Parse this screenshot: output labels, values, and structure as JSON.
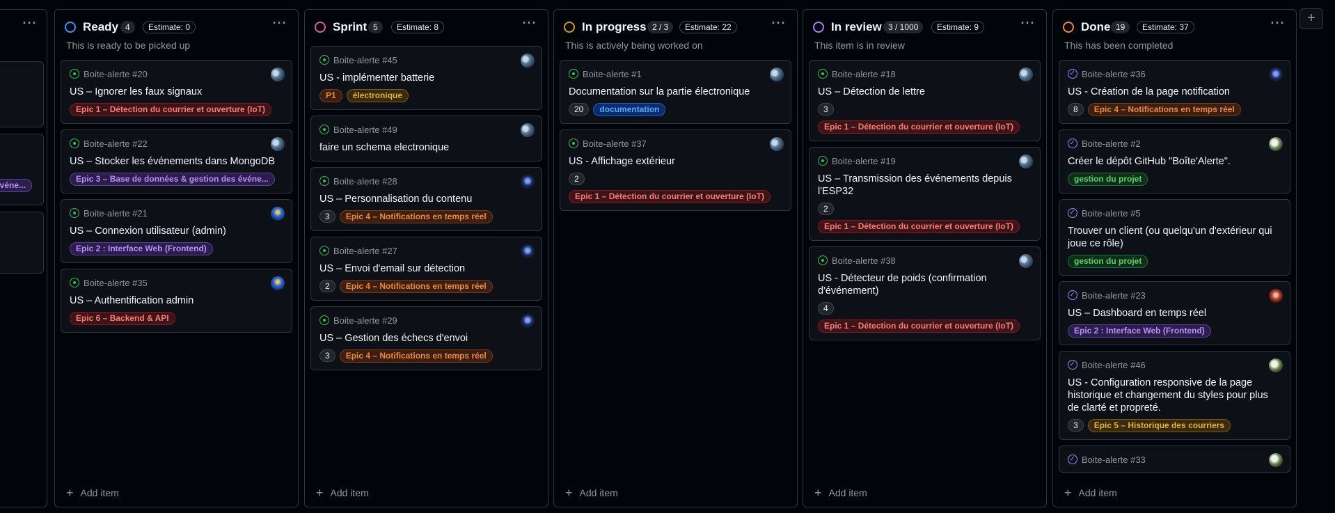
{
  "colors": {
    "ready": "#4493f8",
    "sprint": "#db61a2",
    "in_progress": "#d29922",
    "in_review": "#ab7df8",
    "done": "#f0883e",
    "open_issue": "#3fb950",
    "closed_issue": "#ab7df8"
  },
  "label_styles": {
    "epic1": {
      "bg": "#3b1519",
      "fg": "#ff7b72",
      "border": "#8e1519"
    },
    "epic2": {
      "bg": "#2a1f4a",
      "fg": "#bc8cff",
      "border": "#5a3fa0"
    },
    "epic3": {
      "bg": "#2a1f4a",
      "fg": "#bc8cff",
      "border": "#5a3fa0"
    },
    "epic4": {
      "bg": "#3a1f12",
      "fg": "#f0883e",
      "border": "#7a3a1a"
    },
    "epic5": {
      "bg": "#3a2a0e",
      "fg": "#e3b341",
      "border": "#7a5a12"
    },
    "epic6": {
      "bg": "#3b1519",
      "fg": "#ff7b72",
      "border": "#8e1519"
    },
    "p1": {
      "bg": "#3a1f12",
      "fg": "#f0883e",
      "border": "#7a3a1a"
    },
    "electronique": {
      "bg": "#3a2a0e",
      "fg": "#e3b341",
      "border": "#7a5a12"
    },
    "documentation": {
      "bg": "#0c2d6b",
      "fg": "#58a6ff",
      "border": "#1f5bc4"
    },
    "gestion": {
      "bg": "#0f2e1a",
      "fg": "#56d364",
      "border": "#1f6f36"
    }
  },
  "columns": [
    {
      "title": "Ready",
      "count": "4",
      "estimate": "Estimate: 0",
      "description": "This is ready to be picked up",
      "add_item": "Add item",
      "cards": [
        {
          "ref": "Boite-alerte #20",
          "title": "US – Ignorer les faux signaux",
          "avatar": "avatar-landscape",
          "labels": [
            {
              "text": "Epic 1 – Détection du courrier et ouverture (IoT)",
              "style": "epic1"
            }
          ]
        },
        {
          "ref": "Boite-alerte #22",
          "title": "US – Stocker les événements dans MongoDB",
          "avatar": "avatar-landscape",
          "labels": [
            {
              "text": "Epic 3 – Base de données & gestion des événe...",
              "style": "epic3"
            }
          ]
        },
        {
          "ref": "Boite-alerte #21",
          "title": "US – Connexion utilisateur (admin)",
          "avatar": "avatar-blue",
          "labels": [
            {
              "text": "Epic 2 : Interface Web (Frontend)",
              "style": "epic2"
            }
          ]
        },
        {
          "ref": "Boite-alerte #35",
          "title": "US – Authentification admin",
          "avatar": "avatar-blue",
          "labels": [
            {
              "text": "Epic 6 – Backend & API",
              "style": "epic6"
            }
          ]
        }
      ]
    },
    {
      "title": "Sprint",
      "count": "5",
      "estimate": "Estimate: 8",
      "description": "",
      "add_item": "Add item",
      "cards": [
        {
          "ref": "Boite-alerte #45",
          "title": "US - implémenter batterie",
          "avatar": "avatar-landscape",
          "labels": [
            {
              "text": "P1",
              "style": "p1"
            },
            {
              "text": "électronique",
              "style": "electronique"
            }
          ]
        },
        {
          "ref": "Boite-alerte #49",
          "title": "faire un schema electronique",
          "avatar": "avatar-landscape",
          "labels": []
        },
        {
          "ref": "Boite-alerte #28",
          "title": "US – Personnalisation du contenu",
          "avatar": "avatar-dark",
          "num": "3",
          "labels": [
            {
              "text": "Epic 4 – Notifications en temps réel",
              "style": "epic4"
            }
          ]
        },
        {
          "ref": "Boite-alerte #27",
          "title": "US – Envoi d'email sur détection",
          "avatar": "avatar-dark",
          "num": "2",
          "labels": [
            {
              "text": "Epic 4 – Notifications en temps réel",
              "style": "epic4"
            }
          ]
        },
        {
          "ref": "Boite-alerte #29",
          "title": "US – Gestion des échecs d'envoi",
          "avatar": "avatar-dark",
          "num": "3",
          "labels": [
            {
              "text": "Epic 4 – Notifications en temps réel",
              "style": "epic4"
            }
          ]
        }
      ]
    },
    {
      "title": "In progress",
      "count": "2 / 3",
      "estimate": "Estimate: 22",
      "description": "This is actively being worked on",
      "add_item": "Add item",
      "cards": [
        {
          "ref": "Boite-alerte #1",
          "title": "Documentation sur la partie électronique",
          "avatar": "avatar-landscape",
          "num": "20",
          "labels": [
            {
              "text": "documentation",
              "style": "documentation"
            }
          ]
        },
        {
          "ref": "Boite-alerte #37",
          "title": "US - Affichage extérieur",
          "avatar": "avatar-landscape",
          "num": "2",
          "labels_below": true,
          "labels": [
            {
              "text": "Epic 1 – Détection du courrier et ouverture (IoT)",
              "style": "epic1"
            }
          ]
        }
      ]
    },
    {
      "title": "In review",
      "count": "3 / 1000",
      "estimate": "Estimate: 9",
      "description": "This item is in review",
      "add_item": "Add item",
      "cards": [
        {
          "ref": "Boite-alerte #18",
          "title": "US – Détection de lettre",
          "avatar": "avatar-landscape",
          "num": "3",
          "labels_below": true,
          "labels": [
            {
              "text": "Epic 1 – Détection du courrier et ouverture (IoT)",
              "style": "epic1"
            }
          ]
        },
        {
          "ref": "Boite-alerte #19",
          "title": "US – Transmission des événements depuis l'ESP32",
          "avatar": "avatar-landscape",
          "num": "2",
          "labels_below": true,
          "labels": [
            {
              "text": "Epic 1 – Détection du courrier et ouverture (IoT)",
              "style": "epic1"
            }
          ]
        },
        {
          "ref": "Boite-alerte #38",
          "title": "US - Détecteur de poids (confirmation d'événement)",
          "avatar": "avatar-landscape",
          "num": "4",
          "labels_below": true,
          "labels": [
            {
              "text": "Epic 1 – Détection du courrier et ouverture (IoT)",
              "style": "epic1"
            }
          ]
        }
      ]
    },
    {
      "title": "Done",
      "count": "19",
      "estimate": "Estimate: 37",
      "description": "This has been completed",
      "add_item": "Add item",
      "cards": [
        {
          "ref": "Boite-alerte #36",
          "title": "US - Création de la page notification",
          "avatar": "avatar-dark",
          "closed": true,
          "num": "8",
          "labels": [
            {
              "text": "Epic 4 – Notifications en temps réel",
              "style": "epic4"
            }
          ]
        },
        {
          "ref": "Boite-alerte #2",
          "title": "Créer le dépôt GitHub \"Boîte'Alerte\".",
          "avatar": "avatar-light",
          "closed": true,
          "labels": [
            {
              "text": "gestion du projet",
              "style": "gestion"
            }
          ]
        },
        {
          "ref": "Boite-alerte #5",
          "title": "Trouver un client (ou quelqu'un d'extérieur qui joue ce rôle)",
          "avatar": "",
          "closed": true,
          "labels": [
            {
              "text": "gestion du projet",
              "style": "gestion"
            }
          ]
        },
        {
          "ref": "Boite-alerte #23",
          "title": "US – Dashboard en temps réel",
          "avatar": "avatar-red",
          "closed": true,
          "labels": [
            {
              "text": "Epic 2 : Interface Web (Frontend)",
              "style": "epic2"
            }
          ]
        },
        {
          "ref": "Boite-alerte #46",
          "title": "US - Configuration responsive de la page historique et changement du styles pour plus de clarté et propreté.",
          "avatar": "avatar-light",
          "closed": true,
          "num": "3",
          "labels": [
            {
              "text": "Epic 5 – Historique des courriers",
              "style": "epic5"
            }
          ]
        },
        {
          "ref": "Boite-alerte #33",
          "title": "",
          "avatar": "avatar-light",
          "closed": true,
          "labels": []
        }
      ]
    }
  ],
  "left_partial": {
    "label": "événe..."
  }
}
